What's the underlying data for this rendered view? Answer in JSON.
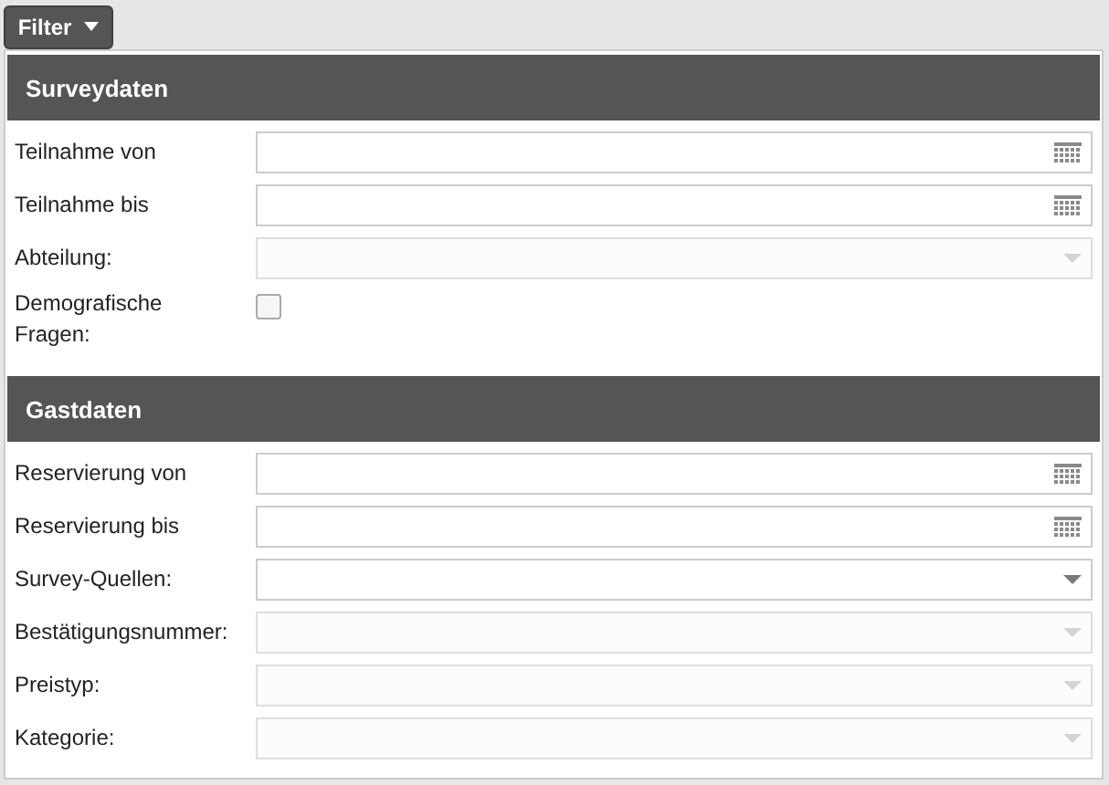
{
  "filter_button": {
    "label": "Filter"
  },
  "sections": [
    {
      "title": "Surveydaten",
      "fields": [
        {
          "kind": "date",
          "label": "Teilnahme von"
        },
        {
          "kind": "date",
          "label": "Teilnahme bis"
        },
        {
          "kind": "select",
          "label": "Abteilung:",
          "disabled": true
        },
        {
          "kind": "checkbox",
          "label": "Demografische Fragen:",
          "checked": false
        }
      ]
    },
    {
      "title": "Gastdaten",
      "fields": [
        {
          "kind": "date",
          "label": "Reservierung von"
        },
        {
          "kind": "date",
          "label": "Reservierung bis"
        },
        {
          "kind": "select",
          "label": "Survey-Quellen:",
          "disabled": false
        },
        {
          "kind": "select",
          "label": "Bestätigungsnummer:",
          "disabled": true
        },
        {
          "kind": "select",
          "label": "Preistyp:",
          "disabled": true
        },
        {
          "kind": "select",
          "label": "Kategorie:",
          "disabled": true
        }
      ]
    }
  ]
}
